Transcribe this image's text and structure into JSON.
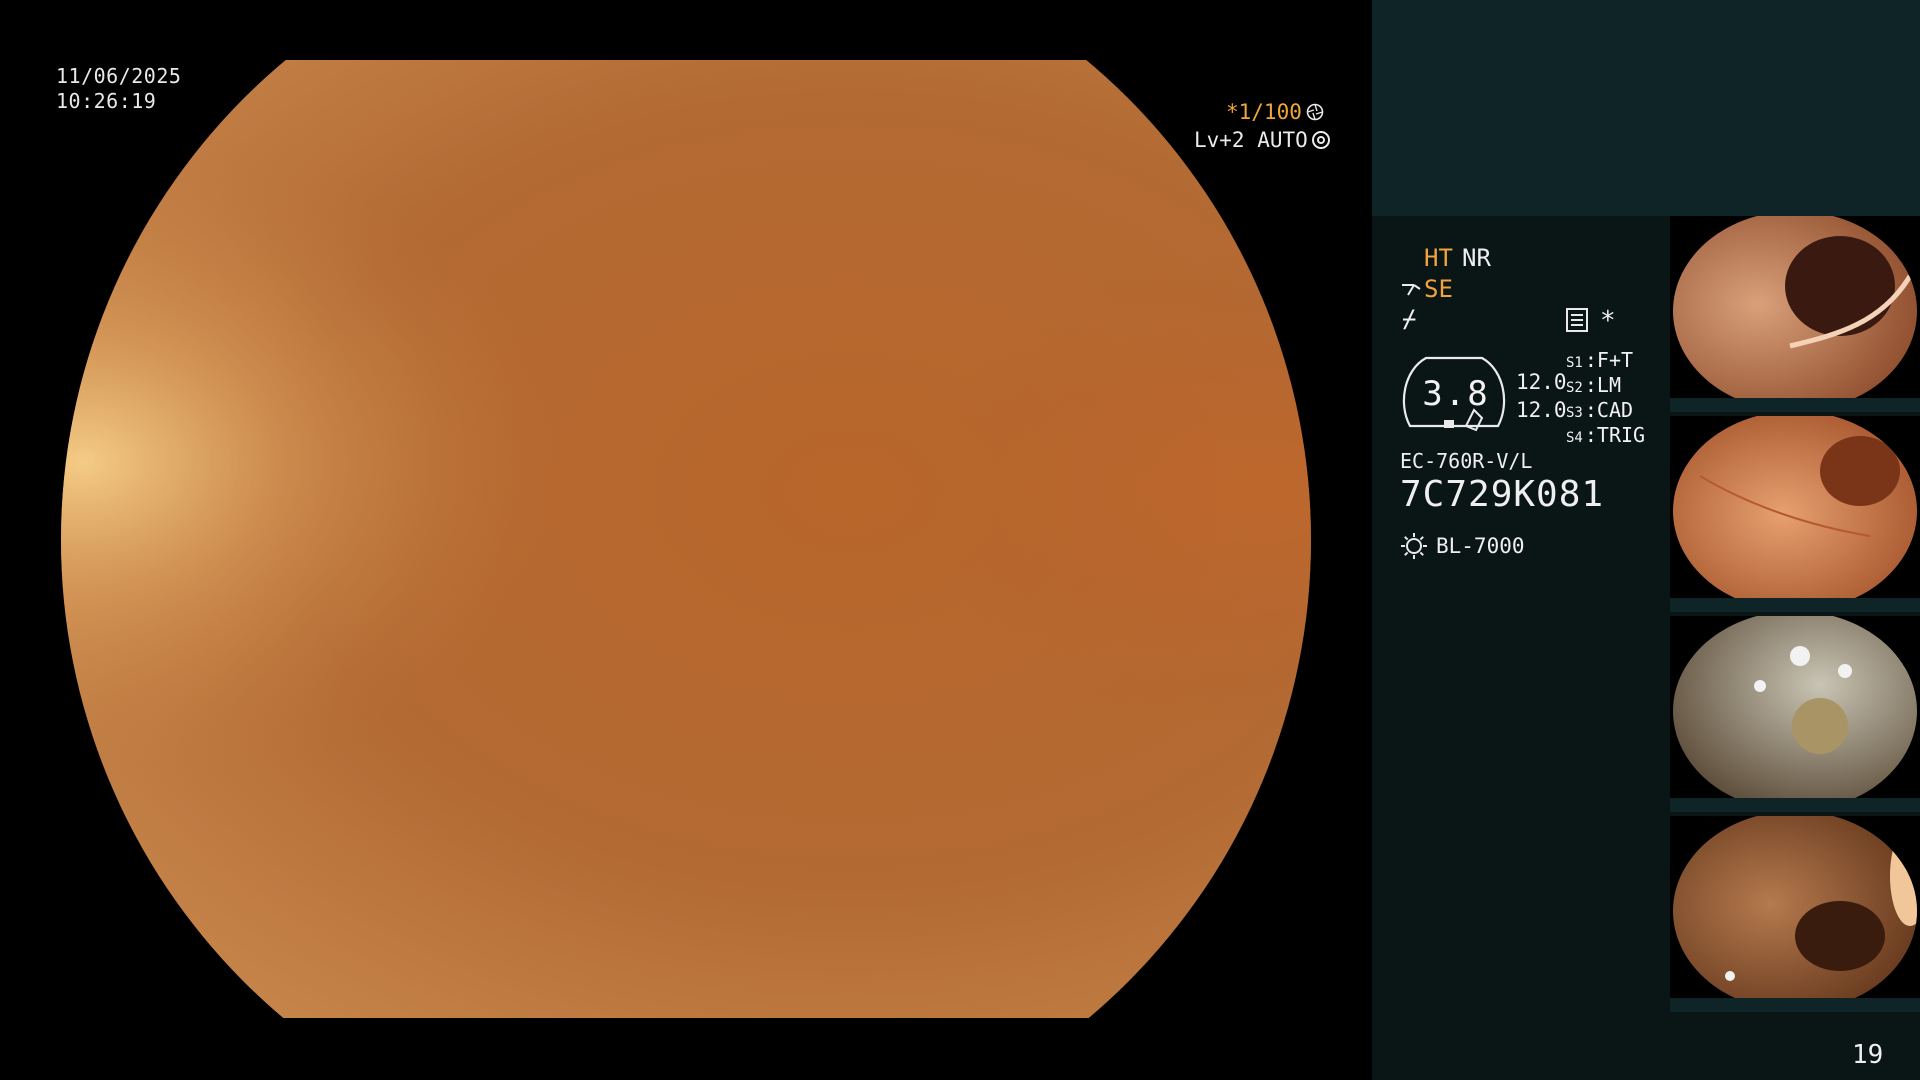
{
  "overlay": {
    "date": "11/06/2025",
    "time": "10:26:19",
    "shutter": "*1/100",
    "level": "Lv+2 AUTO",
    "icons": [
      "aperture-icon",
      "iris-ring-icon"
    ]
  },
  "side_panel": {
    "ht": "HT",
    "nr": "NR",
    "se": "SE",
    "f_symbol": "⌿",
    "asterisk": "*",
    "gauge_value": "3.8",
    "value_top": "12.0",
    "value_bottom": "12.0",
    "switches": [
      {
        "key": "S1",
        "value": "F+T"
      },
      {
        "key": "S2",
        "value": "LM"
      },
      {
        "key": "S3",
        "value": "CAD"
      },
      {
        "key": "S4",
        "value": "TRIG"
      }
    ],
    "model": "EC-760R-V/L",
    "serial": "7C729K081",
    "light_source": "BL-7000"
  },
  "page_number": "19",
  "colors": {
    "accent_orange": "#f2a43a",
    "panel_bg": "#0a1516",
    "panel_header_bg": "#0e2426",
    "scope_orange": "#c0702e"
  }
}
